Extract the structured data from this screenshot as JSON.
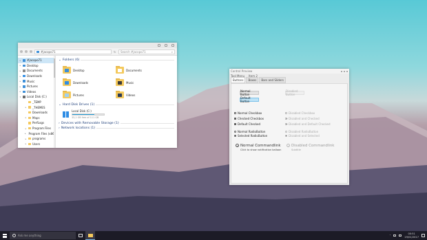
{
  "explorer": {
    "path": "#jacopo71",
    "search_placeholder": "Search #jacopo71",
    "nav": [
      {
        "label": "#jacopo71",
        "icon": "user-folder-icon",
        "color": "#3d8fd8",
        "selected": true,
        "chevron": "▸"
      },
      {
        "label": "Desktop",
        "icon": "desktop-icon",
        "color": "#3d8fd8",
        "selected": false,
        "chevron": "▸"
      },
      {
        "label": "Documents",
        "icon": "documents-icon",
        "color": "#8a8a8a",
        "selected": false,
        "chevron": "▸"
      },
      {
        "label": "Downloads",
        "icon": "downloads-icon",
        "color": "#2f8de4",
        "selected": false,
        "chevron": "▸"
      },
      {
        "label": "Music",
        "icon": "music-icon",
        "color": "#3d8fd8",
        "selected": false,
        "chevron": "▸"
      },
      {
        "label": "Pictures",
        "icon": "pictures-icon",
        "color": "#3d8fd8",
        "selected": false,
        "chevron": "▸"
      },
      {
        "label": "Videos",
        "icon": "videos-icon",
        "color": "#3d8fd8",
        "selected": false,
        "chevron": "▸"
      },
      {
        "label": "Local Disk (C:)",
        "icon": "drive-icon",
        "color": "#6a6a6a",
        "selected": false,
        "chevron": "▾"
      },
      {
        "label": "_TEMP",
        "icon": "folder-icon",
        "color": "#f4c95d",
        "selected": false,
        "chevron": ""
      },
      {
        "label": "_THEMES",
        "icon": "folder-icon",
        "color": "#f4c95d",
        "selected": false,
        "chevron": "▸"
      },
      {
        "label": "Downloads",
        "icon": "folder-icon",
        "color": "#f4c95d",
        "selected": false,
        "chevron": ""
      },
      {
        "label": "Maps",
        "icon": "folder-icon",
        "color": "#f4c95d",
        "selected": false,
        "chevron": "▸"
      },
      {
        "label": "PerfLogs",
        "icon": "folder-icon",
        "color": "#f4c95d",
        "selected": false,
        "chevron": ""
      },
      {
        "label": "Program Files",
        "icon": "folder-icon",
        "color": "#f4c95d",
        "selected": false,
        "chevron": "▸"
      },
      {
        "label": "Program Files (x86)",
        "icon": "folder-icon",
        "color": "#f4c95d",
        "selected": false,
        "chevron": "▸"
      },
      {
        "label": "programs",
        "icon": "folder-icon",
        "color": "#f4c95d",
        "selected": false,
        "chevron": "▸"
      },
      {
        "label": "Users",
        "icon": "folder-icon",
        "color": "#f4c95d",
        "selected": false,
        "chevron": "▸"
      }
    ],
    "folders_header": "Folders (6)",
    "folders": [
      {
        "label": "Desktop",
        "icon": "desktop-folder-icon",
        "badge": "#3d8fd8"
      },
      {
        "label": "Documents",
        "icon": "documents-folder-icon",
        "badge": "#ffffff"
      },
      {
        "label": "Downloads",
        "icon": "downloads-folder-icon",
        "badge": "#2f8de4"
      },
      {
        "label": "Music",
        "icon": "music-folder-icon",
        "badge": "#3a3a3a"
      },
      {
        "label": "Pictures",
        "icon": "pictures-folder-icon",
        "badge": "#9fd0f0"
      },
      {
        "label": "Videos",
        "icon": "videos-folder-icon",
        "badge": "#2b3a55"
      }
    ],
    "drives_header": "Hard Disk Drives (1)",
    "drive": {
      "label": "Local Disk (C:)",
      "free": "33,1 GB free of 111 GB",
      "used_fraction": 0.7
    },
    "removable_header": "Devices with Removable Storage (1)",
    "network_header": "Network locations (1)"
  },
  "control": {
    "title": "Control Preview",
    "menu": [
      "Tool Menu",
      "Item 2"
    ],
    "tabs": [
      "Buttons",
      "Boxes",
      "Bars and Sliders"
    ],
    "buttons": {
      "normal": "Normal Button",
      "default": "Default Button",
      "disabled": "Disabled Button"
    },
    "checkboxes": {
      "normal": "Normal Checkbox",
      "checked": "Checked Checkbox",
      "default": "Default Checked",
      "disabled": "Disabled Checkbox",
      "disabled_checked": "Disabled and Checked",
      "disabled_default": "Disabled and Default Checked"
    },
    "radios": {
      "normal": "Normal RadioButton",
      "selected": "Selected RadioButton",
      "disabled": "Disabled RadioButton",
      "disabled_selected": "Disabled and Selected"
    },
    "commandlinks": {
      "normal": "Normal Commandlink",
      "normal_sub": "Click to show notification balloon",
      "disabled": "Disabled Commandlink",
      "disabled_sub": "Subtitle"
    }
  },
  "taskbar": {
    "search_placeholder": "Ask me anything",
    "time": "00:51",
    "date": "19/01/2017"
  }
}
